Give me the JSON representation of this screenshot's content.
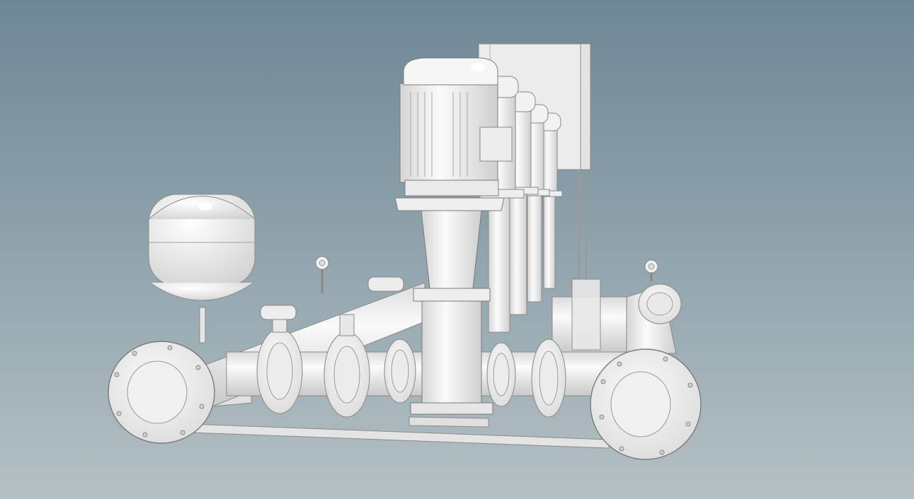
{
  "viewport": {
    "background_top": "#6e8796",
    "background_bottom": "#b4c0c4",
    "model_color": "#eeeeee",
    "edge_color": "#7a7a7a"
  },
  "model": {
    "pump_units": 5,
    "components": [
      "expansion-tank",
      "suction-manifold",
      "discharge-manifold",
      "pressure-gauge",
      "control-cabinet",
      "base-frame"
    ]
  }
}
